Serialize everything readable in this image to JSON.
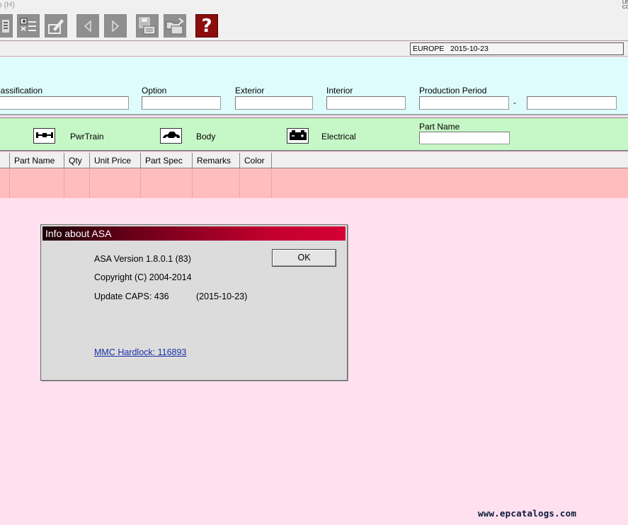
{
  "menubar": {
    "help_menu": "lp (H)"
  },
  "toolbar": {
    "buttons": [
      "search-icon",
      "list-icon",
      "edit-icon",
      "prev-icon",
      "next-icon",
      "save-icon",
      "open-icon",
      "help-icon"
    ],
    "help_glyph": "?"
  },
  "status": {
    "region": "EUROPE",
    "date": "2015-10-23"
  },
  "filters": {
    "classification_label": "lassification",
    "option_label": "Option",
    "exterior_label": "Exterior",
    "interior_label": "Interior",
    "production_period_label": "Production Period",
    "period_separator": "-"
  },
  "categories": {
    "pwrtrain_label": "PwrTrain",
    "body_label": "Body",
    "electrical_label": "Electrical",
    "part_name_label": "Part Name"
  },
  "table": {
    "columns": [
      "Part Name",
      "Qty",
      "Unit Price",
      "Part Spec",
      "Remarks",
      "Color"
    ]
  },
  "dialog": {
    "title": "Info about ASA",
    "version": "ASA Version 1.8.0.1 (83)",
    "copyright": "Copyright (C) 2004-2014",
    "update_caps": "Update CAPS: 436",
    "update_date": "(2015-10-23)",
    "hardlock": "MMC Hardlock: 116893",
    "ok_label": "OK"
  },
  "watermark": "www.epcatalogs.com",
  "colors": {
    "filter_panel": "#dffcfc",
    "category_bar": "#c6f7c6",
    "table_row": "#ffbdbd",
    "background": "#ffe0ee",
    "dialog_title_start": "#1a0008",
    "dialog_title_end": "#d40035",
    "help_button": "#8b0d0d"
  }
}
